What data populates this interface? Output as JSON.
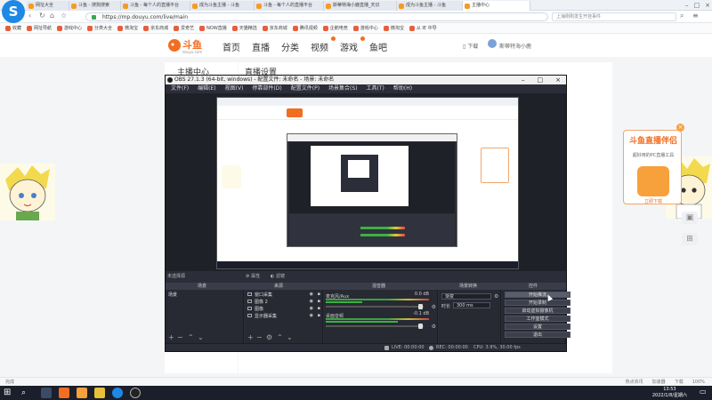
{
  "browser": {
    "tabs": [
      {
        "label": "网址大全",
        "active": false
      },
      {
        "label": "斗鱼 - 搜狗搜索",
        "active": false
      },
      {
        "label": "斗鱼 - 每个人的直播平台",
        "active": false
      },
      {
        "label": "成为斗鱼主播 - 斗鱼",
        "active": false
      },
      {
        "label": "斗鱼 - 每个人的直播平台",
        "active": false
      },
      {
        "label": "斯蒂特海小鹿直播_天识",
        "active": false
      },
      {
        "label": "成为斗鱼主播 - 斗鱼",
        "active": false
      },
      {
        "label": "主播中心",
        "active": true
      }
    ],
    "url": "https://mp.douyu.com/live/main",
    "search_placeholder": "上海刚刚发生开挂事件",
    "bookmarks": [
      "收藏",
      "网址导航",
      "游戏中心",
      "分类大全",
      "微淘宝",
      "京东商城",
      "爱奇艺",
      "NOW直播",
      "天猫精选",
      "京东商城",
      "腾讯视频",
      "企鹅电竞",
      "游戏中心",
      "微淘宝",
      "从 IE 中导"
    ],
    "status_left": "完成",
    "status_right": [
      "热点资讯",
      "加速器",
      "下载",
      "100%"
    ]
  },
  "site": {
    "logo": "斗鱼",
    "logo_sub": "douyu.com",
    "nav": [
      "首页",
      "直播",
      "分类",
      "视频",
      "游戏",
      "鱼吧"
    ],
    "download": "下载",
    "user": "斯蒂特海小鹿",
    "sidebar_title": "主播中心",
    "page_header": "直播设置",
    "promo_title": "斗鱼直播伴侣",
    "promo_sub": "超好用的PC直播工具",
    "promo_btn": "立即下载",
    "promo_close": "×"
  },
  "obs": {
    "title": "OBS 27.1.3 (64-bit, windows) - 配置文件: 未命名 - 场景: 未命名",
    "menu": [
      "文件(F)",
      "编辑(E)",
      "视图(V)",
      "停靠部件(D)",
      "配置文件(P)",
      "场景集合(S)",
      "工具(T)",
      "帮助(H)"
    ],
    "no_source": "未选择源",
    "props_btn": "属性",
    "filter_btn": "滤镜",
    "docks": [
      "场景",
      "来源",
      "混音器",
      "场景转换",
      "控件"
    ],
    "scenes": [
      "场景"
    ],
    "sources": [
      "窗口采集",
      "图像 2",
      "图像",
      "显示器采集"
    ],
    "mixer": [
      {
        "name": "麦克风/Aux",
        "db": "0.0 dB",
        "level": 0.35
      },
      {
        "name": "桌面音频",
        "db": "-0.1 dB",
        "level": 0.7
      }
    ],
    "transition_type": "渐变",
    "transition_duration_label": "时长",
    "transition_duration": "300 ms",
    "controls": [
      "开始推流",
      "开始录制",
      "启动虚拟摄像机",
      "工作室模式",
      "设置",
      "退出"
    ],
    "status": {
      "live": "LIVE: 00:00:00",
      "rec": "REC: 00:00:00",
      "cpu": "CPU: 3.9%, 30.00 fps"
    }
  },
  "taskbar": {
    "time": "13:53",
    "date": "2022/1/8/星期六"
  }
}
